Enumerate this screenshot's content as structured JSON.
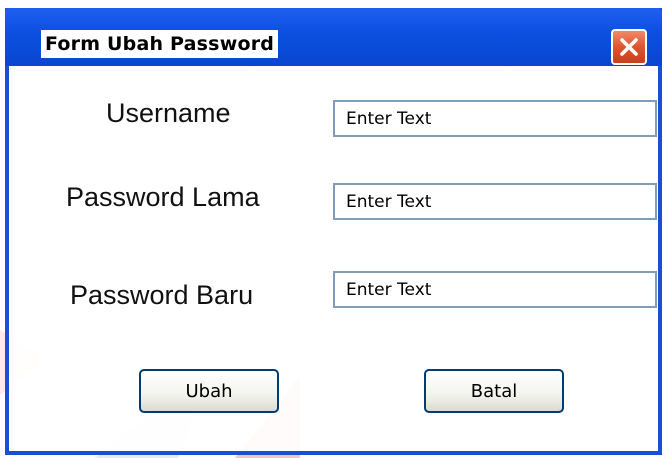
{
  "window": {
    "title": "Form Ubah Password",
    "close_icon": "close-icon"
  },
  "form": {
    "username": {
      "label": "Username",
      "value": "Enter Text"
    },
    "old_password": {
      "label": "Password Lama",
      "value": "Enter Text"
    },
    "new_password": {
      "label": "Password Baru",
      "value": "Enter Text"
    }
  },
  "buttons": {
    "submit_label": "Ubah",
    "cancel_label": "Batal"
  },
  "colors": {
    "titlebar": "#0b4fe0",
    "close_button": "#e0542e",
    "button_border": "#003c74",
    "input_border": "#7f9db9"
  }
}
